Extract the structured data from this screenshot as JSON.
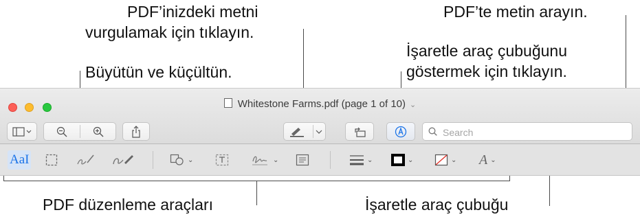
{
  "callouts": {
    "highlight": [
      "PDF’inizdeki metni",
      "vurgulamak için tıklayın."
    ],
    "search": "PDF’te metin arayın.",
    "markup_toggle": [
      "İşaretle araç çubuğunu",
      "göstermek için tıklayın."
    ],
    "zoom": "Büyütün ve küçültün.",
    "edit_tools": "PDF düzenleme araçları",
    "markup_bar": "İşaretle araç çubuğu"
  },
  "window": {
    "title": "Whitestone Farms.pdf (page 1 of 10)",
    "search_placeholder": "Search"
  },
  "toolbar_icons": [
    "sidebar-icon",
    "zoom-out-icon",
    "zoom-in-icon",
    "share-icon",
    "highlight-icon",
    "rotate-icon",
    "markup-icon",
    "search-icon"
  ],
  "markup_tool_icons": [
    "text-selection-icon",
    "rectangular-selection-icon",
    "sketch-icon",
    "draw-icon",
    "shapes-icon",
    "text-box-icon",
    "sign-icon",
    "note-icon",
    "shape-style-icon",
    "border-color-icon",
    "fill-color-icon",
    "text-style-icon"
  ],
  "markup_text_tool_label": "AaI",
  "colors": {
    "accent": "#1a73e8",
    "traffic_close": "#fc5f57",
    "traffic_minimize": "#fdbc2e",
    "traffic_zoom": "#29c840"
  }
}
